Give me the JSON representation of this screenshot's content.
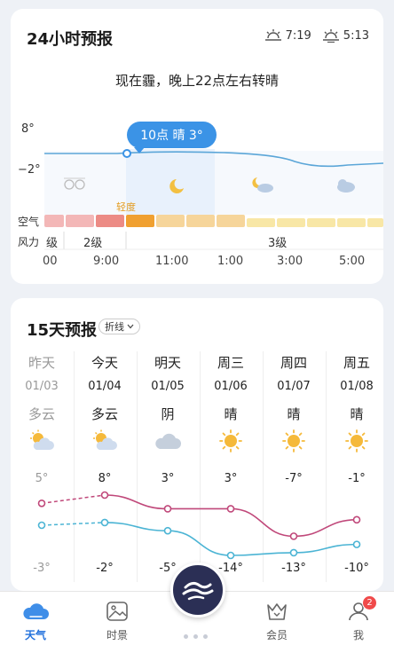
{
  "hourly": {
    "title": "24小时预报",
    "sunrise": "7:19",
    "sunset": "5:13",
    "summary": "现在霾，晚上22点左右转晴",
    "tooltip": "10点 晴 3°",
    "y_max_label": "8°",
    "y_min_label": "−2°",
    "air_label": "空气",
    "air_quality_text": "轻度",
    "wind_label": "风力",
    "wind_segments": [
      "级",
      "2级",
      "3级"
    ],
    "times": [
      "00",
      "9:00",
      "11:00",
      "1:00",
      "3:00",
      "5:00"
    ],
    "colors": {
      "line": "#5ba6d8",
      "tooltip": "#3b93e6"
    }
  },
  "daily": {
    "title": "15天预报",
    "mode_chip": "折线",
    "days": [
      {
        "name": "昨天",
        "date": "01/03",
        "cond": "多云",
        "icon": "partly-cloudy-icon",
        "high": "5°",
        "low": "-3°"
      },
      {
        "name": "今天",
        "date": "01/04",
        "cond": "多云",
        "icon": "partly-cloudy-icon",
        "high": "8°",
        "low": "-2°"
      },
      {
        "name": "明天",
        "date": "01/05",
        "cond": "阴",
        "icon": "cloud-icon",
        "high": "3°",
        "low": "-5°"
      },
      {
        "name": "周三",
        "date": "01/06",
        "cond": "晴",
        "icon": "sun-icon",
        "high": "3°",
        "low": "-14°"
      },
      {
        "name": "周四",
        "date": "01/07",
        "cond": "晴",
        "icon": "sun-icon",
        "high": "-7°",
        "low": "-13°"
      },
      {
        "name": "周五",
        "date": "01/08",
        "cond": "晴",
        "icon": "sun-icon",
        "high": "-1°",
        "low": "-10°"
      }
    ],
    "colors": {
      "high": "#c0487a",
      "low": "#4bb4d4"
    }
  },
  "chart_data": {
    "type": "line",
    "categories": [
      "01/03",
      "01/04",
      "01/05",
      "01/06",
      "01/07",
      "01/08"
    ],
    "series": [
      {
        "values": [
          5,
          8,
          3,
          3,
          -7,
          -1
        ]
      },
      {
        "values": [
          -3,
          -2,
          -5,
          -14,
          -13,
          -10
        ]
      }
    ]
  },
  "tabs": [
    {
      "label": "天气",
      "icon": "cloud-tab-icon",
      "active": true
    },
    {
      "label": "时景",
      "icon": "photo-icon",
      "active": false
    },
    {
      "label": "会员",
      "icon": "crown-icon",
      "active": false
    },
    {
      "label": "我",
      "icon": "person-icon",
      "active": false,
      "badge": "2"
    }
  ]
}
